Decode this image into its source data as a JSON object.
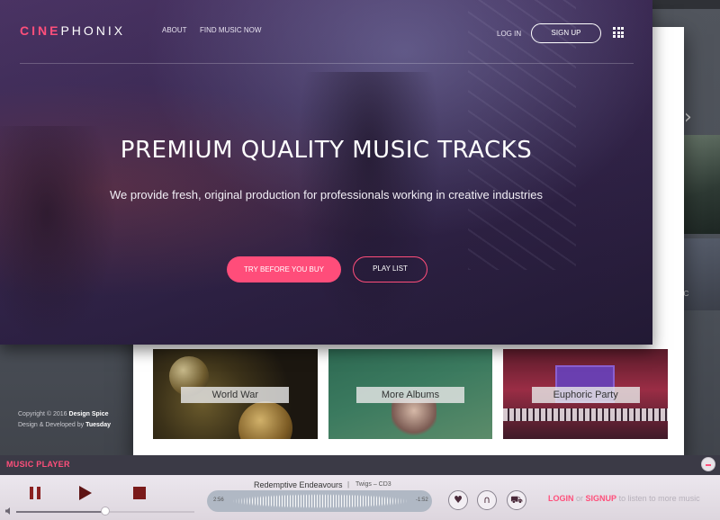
{
  "brand": {
    "logo_part1": "CINE",
    "logo_part2": "PHONIX"
  },
  "nav": {
    "about": "ABOUT",
    "find_music": "FIND MUSIC NOW",
    "login": "LOG IN",
    "signup": "SIGN UP",
    "menu_icon": "grid-menu-icon"
  },
  "hero": {
    "title": "PREMIUM QUALITY MUSIC TRACKS",
    "subtitle": "We provide fresh, original production for professionals working in creative industries",
    "primary_button": "TRY BEFORE YOU BUY",
    "secondary_button": "PLAY LIST"
  },
  "tiles": [
    {
      "label": "World War"
    },
    {
      "label": "More Albums"
    },
    {
      "label": "Euphoric Party"
    }
  ],
  "background_page": {
    "copyright_line1_prefix": "Copyright © 2016 ",
    "copyright_line1_name": "Design Spice",
    "copyright_line2_prefix": "Design & Developed by ",
    "copyright_line2_name": "Tuesday",
    "side_text": "SIC"
  },
  "player": {
    "title": "MUSIC PLAYER",
    "track_name": "Redemptive Endeavours",
    "separator": "|",
    "album": "Twigs – CD3",
    "time_elapsed": "2:56",
    "time_remaining": "-1:52",
    "seek_progress": 0.5,
    "cta_login": "LOGIN",
    "cta_or": "or",
    "cta_signup": "SIGNUP",
    "cta_rest": "to listen to more music"
  },
  "colors": {
    "accent": "#ff4f7b",
    "hero_bg": "#3a2c55",
    "player_bg": "#ece7ee"
  }
}
